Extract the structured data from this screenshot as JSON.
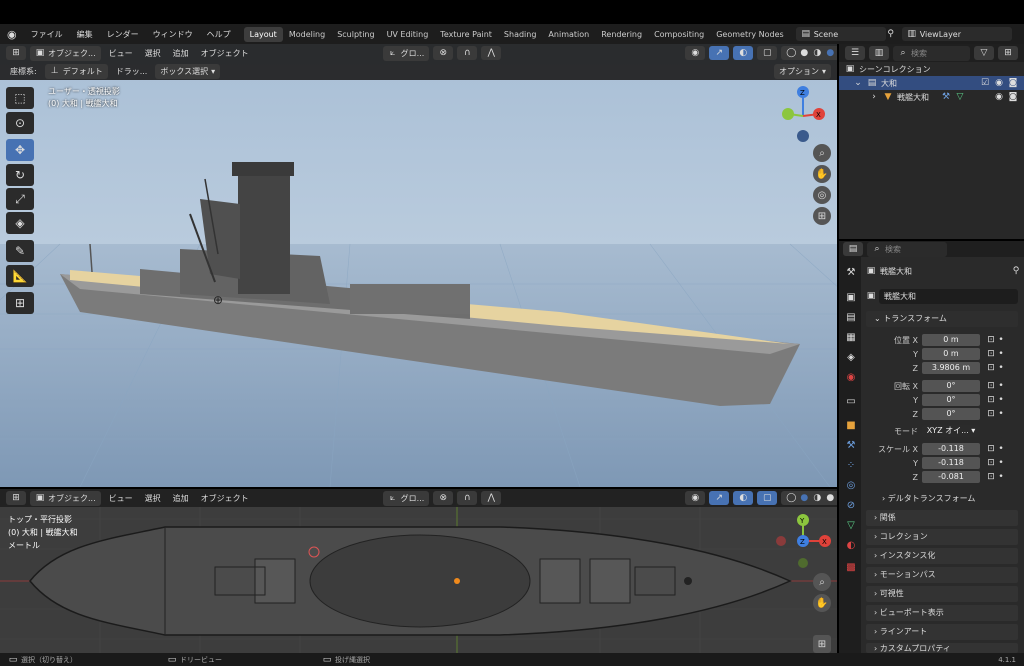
{
  "menu": {
    "items": [
      "ファイル",
      "編集",
      "レンダー",
      "ウィンドウ",
      "ヘルプ"
    ],
    "workspaces": [
      "Layout",
      "Modeling",
      "Sculpting",
      "UV Editing",
      "Texture Paint",
      "Shading",
      "Animation",
      "Rendering",
      "Compositing",
      "Geometry Nodes"
    ],
    "active_workspace": "Layout",
    "scene": "Scene",
    "view_layer": "ViewLayer"
  },
  "viewport_top": {
    "mode": "オブジェク...",
    "menus": [
      "ビュー",
      "選択",
      "追加",
      "オブジェクト"
    ],
    "transform_orientation": "グロ...",
    "coord_label": "座標系:",
    "coord_value": "デフォルト",
    "drag_label": "ドラッ...",
    "select_mode": "ボックス選択",
    "options": "オプション",
    "view_name": "ユーザー・透視投影",
    "collection_info": "(0) 大和 | 戦艦大和"
  },
  "viewport_bottom": {
    "mode": "オブジェク...",
    "menus": [
      "ビュー",
      "選択",
      "追加",
      "オブジェクト"
    ],
    "transform_orientation": "グロ...",
    "view_name": "トップ・平行投影",
    "collection_info": "(0) 大和 | 戦艦大和",
    "unit": "メートル"
  },
  "outliner": {
    "search_placeholder": "検索",
    "root": "シーンコレクション",
    "collection": "大和",
    "object": "戦艦大和"
  },
  "properties": {
    "search_placeholder": "検索",
    "object_name": "戦艦大和",
    "data_name": "戦艦大和",
    "transform_header": "トランスフォーム",
    "location_label": "位置 X",
    "loc_x": "0 m",
    "loc_y": "0 m",
    "loc_z": "3.9806 m",
    "rotation_label": "回転 X",
    "rot_x": "0°",
    "rot_y": "0°",
    "rot_z": "0°",
    "mode_label": "モード",
    "mode_value": "XYZ オイ...",
    "scale_label": "スケール X",
    "scale_x": "-0.118",
    "scale_y": "-0.118",
    "scale_z": "-0.081",
    "axis_y": "Y",
    "axis_z": "Z",
    "delta": "デルタトランスフォーム",
    "sections": [
      "関係",
      "コレクション",
      "インスタンス化",
      "モーションパス",
      "可視性",
      "ビューポート表示",
      "ラインアート",
      "カスタムプロパティ"
    ]
  },
  "status": {
    "select": "選択（切り替え）",
    "dolly": "ドリービュー",
    "lasso": "投げ縄選択",
    "version": "4.1.1"
  },
  "colors": {
    "accent": "#4772b3",
    "axis_x": "#e0423a",
    "axis_y": "#8cc63e",
    "axis_z": "#3f7fe0"
  }
}
